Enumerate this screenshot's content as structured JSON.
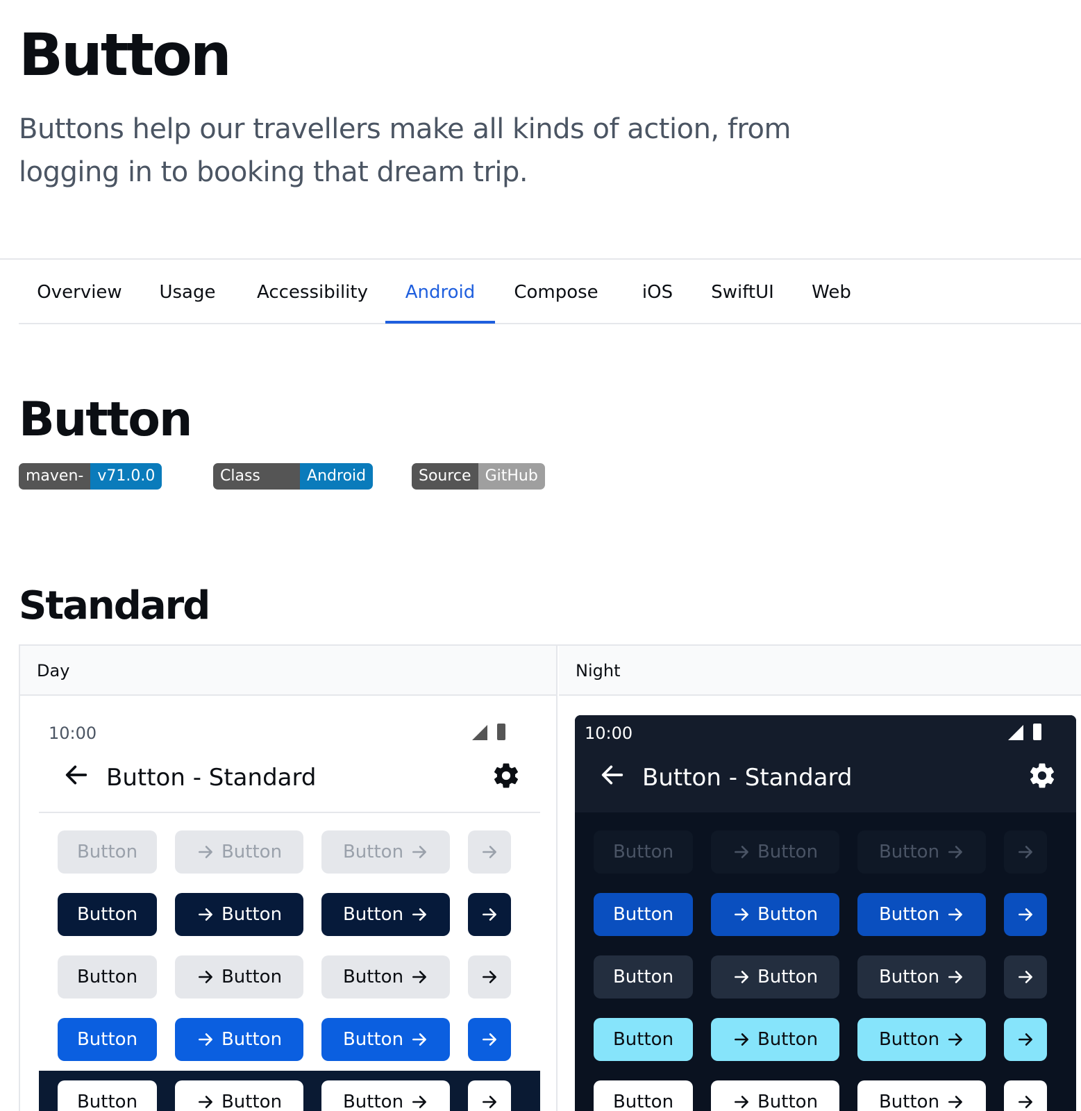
{
  "header": {
    "title": "Button",
    "intro": "Buttons help our travellers make all kinds of action, from logging in to booking that dream trip."
  },
  "tabs": [
    {
      "label": "Overview"
    },
    {
      "label": "Usage"
    },
    {
      "label": "Accessibility"
    },
    {
      "label": "Android",
      "active": true
    },
    {
      "label": "Compose"
    },
    {
      "label": "iOS"
    },
    {
      "label": "SwiftUI"
    },
    {
      "label": "Web"
    }
  ],
  "section": {
    "title": "Button",
    "badges": [
      {
        "key": "maven-central",
        "value": "v71.0.0",
        "color": "#0a7bbb"
      },
      {
        "key": "Class reference",
        "value": "Android",
        "color": "#0a7bbb"
      },
      {
        "key": "Source code",
        "value": "GitHub",
        "color": "#9f9f9f"
      }
    ]
  },
  "standard": {
    "title": "Standard",
    "columns": {
      "day": "Day",
      "night": "Night"
    },
    "status_time": "10:00",
    "appbar_title": "Button - Standard",
    "button_label": "Button"
  },
  "colors": {
    "accent": "#1f5fde",
    "day_rows": [
      {
        "bg": "#e5e7eb",
        "fg": "#9aa1ab"
      },
      {
        "bg": "#061a3a",
        "fg": "#ffffff"
      },
      {
        "bg": "#e5e7eb",
        "fg": "#0b0e13"
      },
      {
        "bg": "#0b5fe0",
        "fg": "#ffffff"
      },
      {
        "bg": "#ffffff",
        "fg": "#0b0e13"
      }
    ],
    "night_rows": [
      {
        "bg": "#0f1826",
        "fg": "#4a5465"
      },
      {
        "bg": "#0a4fbf",
        "fg": "#ffffff"
      },
      {
        "bg": "#232e3f",
        "fg": "#ffffff"
      },
      {
        "bg": "#86e4fb",
        "fg": "#0b0e13"
      },
      {
        "bg": "#ffffff",
        "fg": "#0b0e13"
      }
    ]
  },
  "icons": {
    "back": "arrow-left-icon",
    "settings": "gear-icon",
    "arrow": "arrow-right-icon",
    "signal": "signal-icon",
    "battery": "battery-icon"
  }
}
